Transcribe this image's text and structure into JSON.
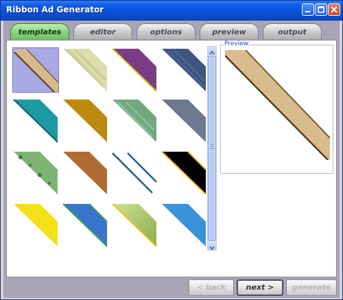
{
  "window": {
    "title": "Ribbon Ad Generator"
  },
  "tabs": [
    {
      "label": "templates",
      "active": true
    },
    {
      "label": "editor",
      "active": false
    },
    {
      "label": "options",
      "active": false
    },
    {
      "label": "preview",
      "active": false
    },
    {
      "label": "output",
      "active": false
    }
  ],
  "preview": {
    "label": "Preview:"
  },
  "templates": [
    {
      "name": "tan-torn",
      "selected": true
    },
    {
      "name": "pale-green-pattern"
    },
    {
      "name": "purple-gold"
    },
    {
      "name": "navy-weave"
    },
    {
      "name": "teal"
    },
    {
      "name": "gold"
    },
    {
      "name": "green-speckle"
    },
    {
      "name": "slate"
    },
    {
      "name": "leafy-green"
    },
    {
      "name": "copper"
    },
    {
      "name": "twin-lines"
    },
    {
      "name": "black-gold"
    },
    {
      "name": "yellow"
    },
    {
      "name": "blue-green-trim"
    },
    {
      "name": "olive-gradient"
    },
    {
      "name": "sky-blue"
    }
  ],
  "buttons": {
    "back": "< back",
    "next": "next >",
    "generate": "generate"
  }
}
